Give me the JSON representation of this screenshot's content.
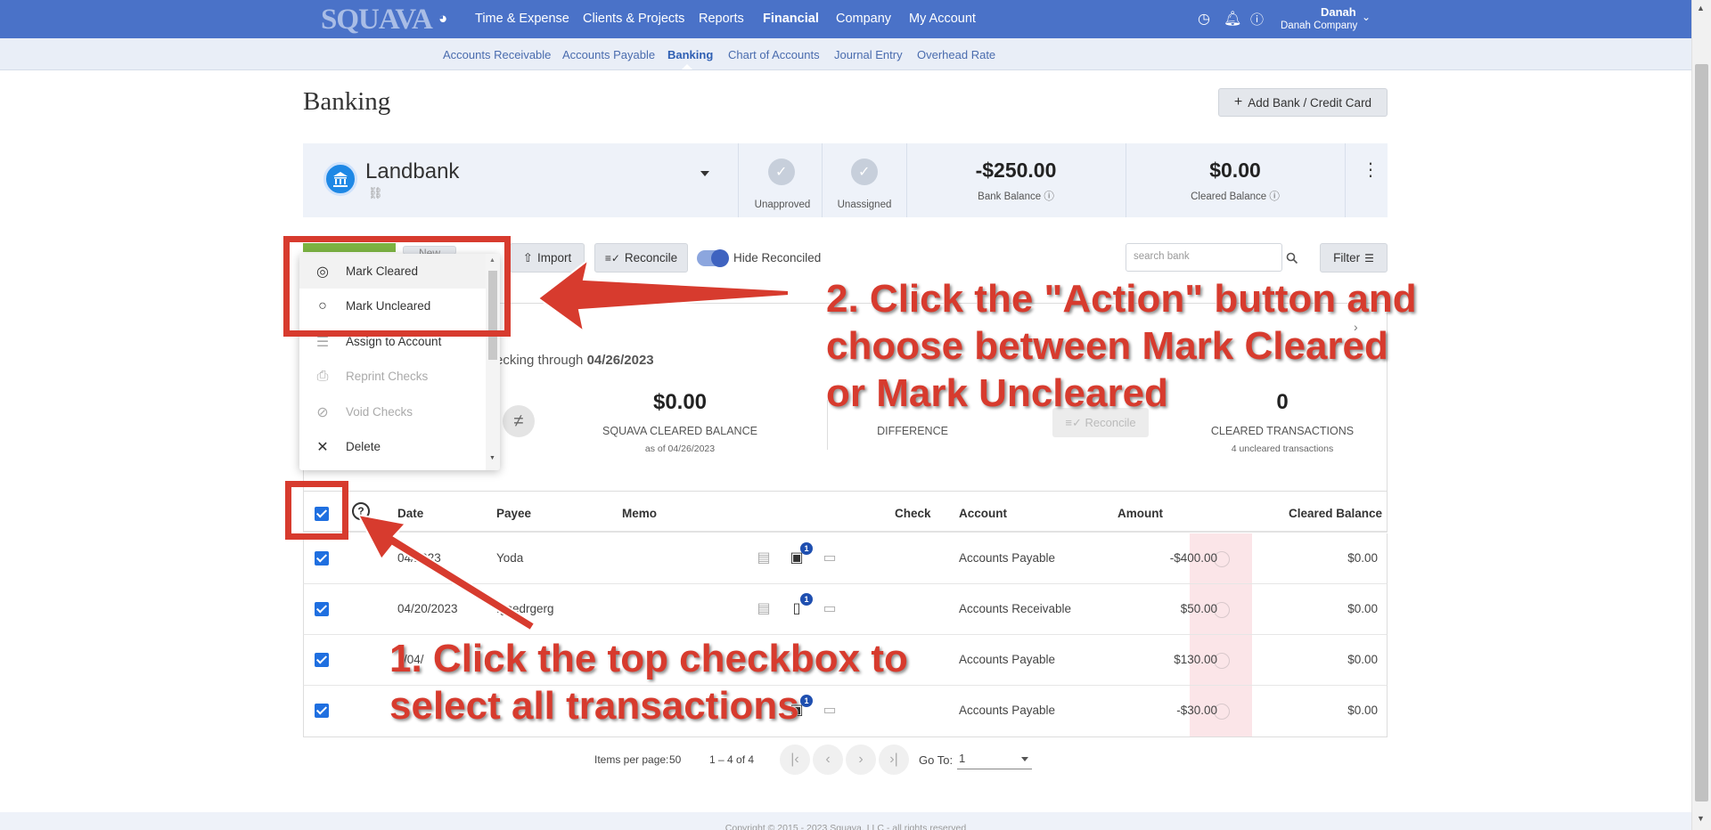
{
  "nav": {
    "logo": "SQUAVA",
    "items": [
      "Time & Expense",
      "Clients & Projects",
      "Reports",
      "Financial",
      "Company",
      "My Account"
    ],
    "active": "Financial",
    "user_name": "Danah",
    "user_company": "Danah Company"
  },
  "subnav": {
    "items": [
      "Accounts Receivable",
      "Accounts Payable",
      "Banking",
      "Chart of Accounts",
      "Journal Entry",
      "Overhead Rate"
    ],
    "active": "Banking"
  },
  "page": {
    "title": "Banking",
    "add_button": "Add Bank / Credit Card"
  },
  "bank_card": {
    "name": "Landbank",
    "unapproved_label": "Unapproved",
    "unassigned_label": "Unassigned",
    "bank_balance": "-$250.00",
    "bank_balance_label": "Bank Balance",
    "cleared_balance": "$0.00",
    "cleared_balance_label": "Cleared Balance"
  },
  "toolbar": {
    "new_label": "New",
    "import_label": "Import",
    "reconcile_label": "Reconcile",
    "hide_reconciled_label": "Hide Reconciled",
    "hide_reconciled_on": true,
    "search_placeholder": "search bank",
    "filter_label": "Filter"
  },
  "reconcile_panel": {
    "through_prefix": "ecking through",
    "through_date": "04/26/2023",
    "squava_balance": "$0.00",
    "squava_balance_label": "SQUAVA CLEARED BALANCE",
    "squava_balance_sub": "as of 04/26/2023",
    "difference_label": "DIFFERENCE",
    "reconcile_button": "Reconcile",
    "cleared_count": "0",
    "cleared_label": "CLEARED TRANSACTIONS",
    "cleared_sub": "4 uncleared transactions"
  },
  "action_menu": [
    {
      "label": "Mark Cleared",
      "icon": "check-circle-icon",
      "disabled": false
    },
    {
      "label": "Mark Uncleared",
      "icon": "circle-icon",
      "disabled": false
    },
    {
      "label": "Assign to Account",
      "icon": "list-icon",
      "disabled": false
    },
    {
      "label": "Reprint Checks",
      "icon": "printer-icon",
      "disabled": true
    },
    {
      "label": "Void Checks",
      "icon": "ban-icon",
      "disabled": true
    },
    {
      "label": "Delete",
      "icon": "close-icon",
      "disabled": false
    }
  ],
  "table": {
    "columns": [
      "Date",
      "Payee",
      "Memo",
      "Check",
      "Account",
      "Amount",
      "Cleared Balance"
    ],
    "rows": [
      {
        "date": "04/2023",
        "payee": "Yoda",
        "account": "Accounts Payable",
        "amount": "-$400.00",
        "cleared_balance": "$0.00",
        "badge": "1"
      },
      {
        "date": "04/20/2023",
        "payee": "fgsedrgerg",
        "account": "Accounts Receivable",
        "amount": "$50.00",
        "cleared_balance": "$0.00",
        "badge": "1"
      },
      {
        "date": "/04/",
        "payee": "",
        "account": "Accounts Payable",
        "amount": "$130.00",
        "cleared_balance": "$0.00",
        "badge": ""
      },
      {
        "date": "",
        "payee": "",
        "account": "Accounts Payable",
        "amount": "-$30.00",
        "cleared_balance": "$0.00",
        "badge": "1"
      }
    ]
  },
  "pagination": {
    "items_per_page_label": "Items per page:",
    "items_per_page": "50",
    "range": "1 – 4 of 4",
    "goto_label": "Go To:",
    "goto_value": "1"
  },
  "footer": "Copyright © 2015 - 2023 Squava, LLC - all rights reserved",
  "annotations": {
    "step2": [
      "2. Click the \"Action\" button and",
      "choose between Mark Cleared",
      "or Mark Uncleared"
    ],
    "step1": [
      "1. Click the top checkbox to",
      "select all transactions"
    ],
    "color": "#d73b2e"
  }
}
